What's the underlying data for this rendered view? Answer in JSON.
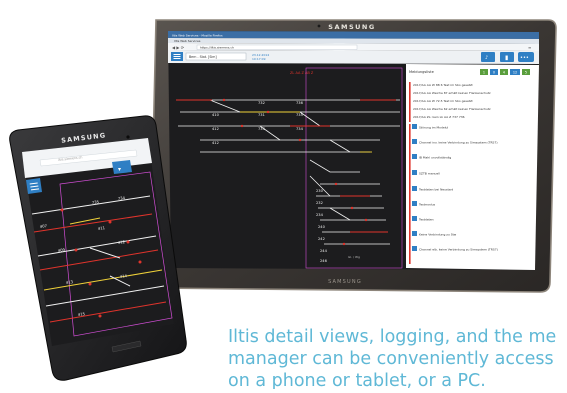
{
  "tablet": {
    "brand_top": "SAMSUNG",
    "brand_bottom": "SAMSUNG",
    "browser_tabs": [
      "Iltis Web Services - Mozilla Firefox",
      "Iltis Web Services"
    ],
    "url": "https://iltis.siemens.ch",
    "station_select": "Bern - Stat. [Sim]",
    "date": "23.12.2014",
    "time": "10:17:09",
    "track_numbers": [
      "732",
      "731",
      "733",
      "410",
      "412",
      "412",
      "736",
      "735",
      "734",
      "230",
      "232",
      "234",
      "240",
      "242",
      "244",
      "246"
    ],
    "track_label": "Gl. / Wg",
    "log_header": "Meldungsliste",
    "log_counts": [
      "1",
      "0",
      "4",
      "12",
      "5"
    ],
    "log_entries": [
      "2017/AA  AA W 88 6 Test im Sbo gesetzt",
      "2017/AA  AA Weiche 87 erhält keinen Flankenschutz",
      "2017/AA  AA W 72.5 Test im Sbo gesetzt",
      "2017/AA  AA Weiche 62 erhält keinen Flankenschutz",
      "2017/AA  ZL: kein Lk AA Z 737 736"
    ],
    "alarm_entries": [
      "Störung im Modelul",
      "Channel inv. keine Verbindung zu Simsystem (TRS7)",
      "IB Mahl unvollständig",
      "SZTB manuell",
      "Testdaten bei Neustart",
      "Testmodus",
      "Testdaten",
      "Keine Verbindung zu Stw",
      "Channel elb. keine Verbindung zu Simsystem (TRS7)"
    ]
  },
  "phone": {
    "brand": "SAMSUNG",
    "url_hint": "iltis.siemens.ch",
    "track_numbers": [
      "735",
      "734",
      "407",
      "411",
      "409",
      "412",
      "413",
      "414",
      "415"
    ]
  },
  "caption": {
    "line1": "Iltis detail views, logging, and the me",
    "line2": "manager can be conveniently access",
    "line3": "on a phone or tablet, or a PC."
  },
  "colors": {
    "caption": "#5fb8d6",
    "screen_bg": "#1c1c1e",
    "track_white": "#f2f2f2",
    "track_red": "#e0342c",
    "track_yellow": "#f0d23a",
    "track_magenta": "#d24ed6",
    "phone_header": "#2f7fc4"
  }
}
